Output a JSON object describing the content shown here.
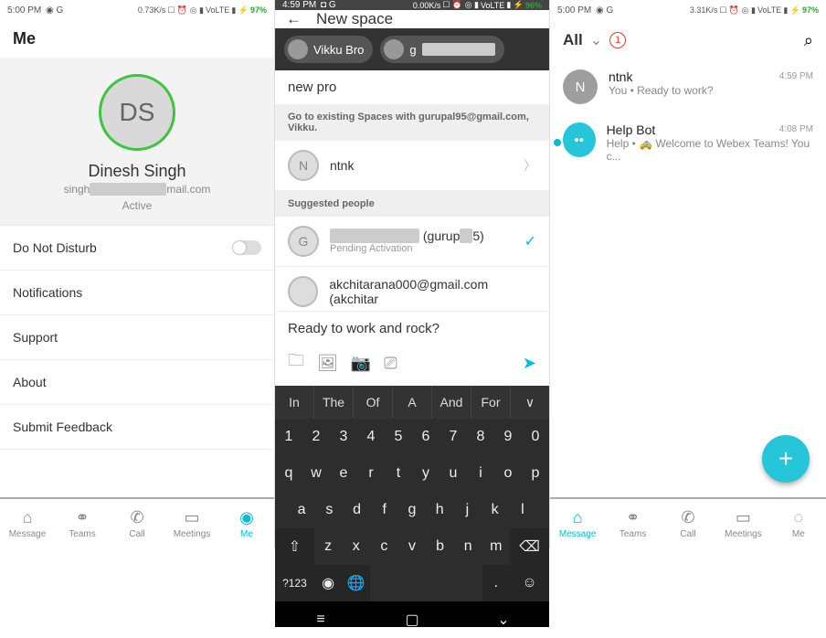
{
  "status": {
    "p1": {
      "time": "5:00 PM",
      "rate": "0.73K/s",
      "net": "VoLTE",
      "bat": "97%"
    },
    "p2": {
      "time": "4:59 PM",
      "rate": "0.00K/s",
      "net": "VoLTE",
      "bat": "96%"
    },
    "p3": {
      "time": "5:00 PM",
      "rate": "3.31K/s",
      "net": "VoLTE",
      "bat": "97%"
    }
  },
  "pane1": {
    "header": "Me",
    "initials": "DS",
    "name": "Dinesh Singh",
    "email_prefix": "singh",
    "email_suffix": "mail.com",
    "active": "Active",
    "items": {
      "dnd": "Do Not Disturb",
      "notif": "Notifications",
      "support": "Support",
      "about": "About",
      "feedback": "Submit Feedback"
    },
    "nav": {
      "message": "Message",
      "teams": "Teams",
      "call": "Call",
      "meetings": "Meetings",
      "me": "Me"
    }
  },
  "pane2": {
    "title": "New space",
    "chip1": "Vikku Bro",
    "chip2": "g",
    "search": "new pro",
    "hint": "Go to existing Spaces with gurupal95@gmail.com, Vikku.",
    "r1": {
      "initial": "N",
      "name": "ntnk"
    },
    "suggested": "Suggested people",
    "r2": {
      "initial": "G",
      "name": "(gurup",
      "name2": "5)",
      "sub": "Pending Activation"
    },
    "r3": "akchitarana000@gmail.com (akchitar",
    "compose": "Ready to work and rock?",
    "sugg": [
      "In",
      "The",
      "Of",
      "A",
      "And",
      "For",
      "∨"
    ],
    "numrow": [
      "1",
      "2",
      "3",
      "4",
      "5",
      "6",
      "7",
      "8",
      "9",
      "0"
    ],
    "qrow": [
      "q",
      "w",
      "e",
      "r",
      "t",
      "y",
      "u",
      "i",
      "o",
      "p"
    ],
    "arow": [
      "a",
      "s",
      "d",
      "f",
      "g",
      "h",
      "j",
      "k",
      "l"
    ],
    "zrow": [
      "z",
      "x",
      "c",
      "v",
      "b",
      "n",
      "m"
    ],
    "shift": "⇧",
    "bksp": "⌫",
    "sym": "?123",
    "globe": "🌐",
    "emoji": "☺"
  },
  "pane3": {
    "all": "All",
    "badge": "1",
    "c1": {
      "initial": "N",
      "name": "ntnk",
      "sub": "You •  Ready to work?",
      "time": "4:59 PM"
    },
    "c2": {
      "name": "Help Bot",
      "sub": "Help •  🚕 Welcome to Webex Teams! You c...",
      "time": "4:08 PM"
    },
    "nav": {
      "message": "Message",
      "teams": "Teams",
      "call": "Call",
      "meetings": "Meetings",
      "me": "Me"
    }
  }
}
